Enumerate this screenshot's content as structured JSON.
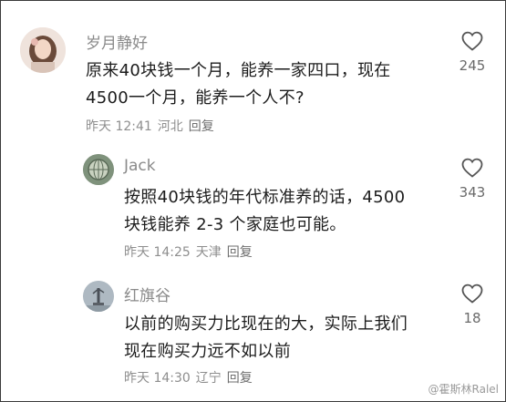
{
  "comments": [
    {
      "username": "岁月静好",
      "lines": [
        "原来40块钱一个月，能养一家四口，现在",
        "4500一个月，能养一个人不?"
      ],
      "time": "昨天 12:41",
      "location": "河北",
      "reply": "回复",
      "likes": "245",
      "avatar_icon": "woman-portrait-avatar"
    },
    {
      "username": "Jack",
      "lines": [
        "按照40块钱的年代标准养的话，4500",
        "块钱能养 2-3 个家庭也可能。"
      ],
      "time": "昨天 14:25",
      "location": "天津",
      "reply": "回复",
      "likes": "343",
      "avatar_icon": "globe-avatar"
    },
    {
      "username": "红旗谷",
      "lines": [
        "以前的购买力比现在的大，实际上我们",
        "现在购买力远不如以前"
      ],
      "time": "昨天 14:30",
      "location": "辽宁",
      "reply": "回复",
      "likes": "18",
      "avatar_icon": "statue-avatar"
    }
  ],
  "watermark": "@霍斯林Ralel",
  "colors": {
    "username": "#8a8a8a",
    "meta": "#8e8e8e",
    "text": "#1c1c1c"
  }
}
